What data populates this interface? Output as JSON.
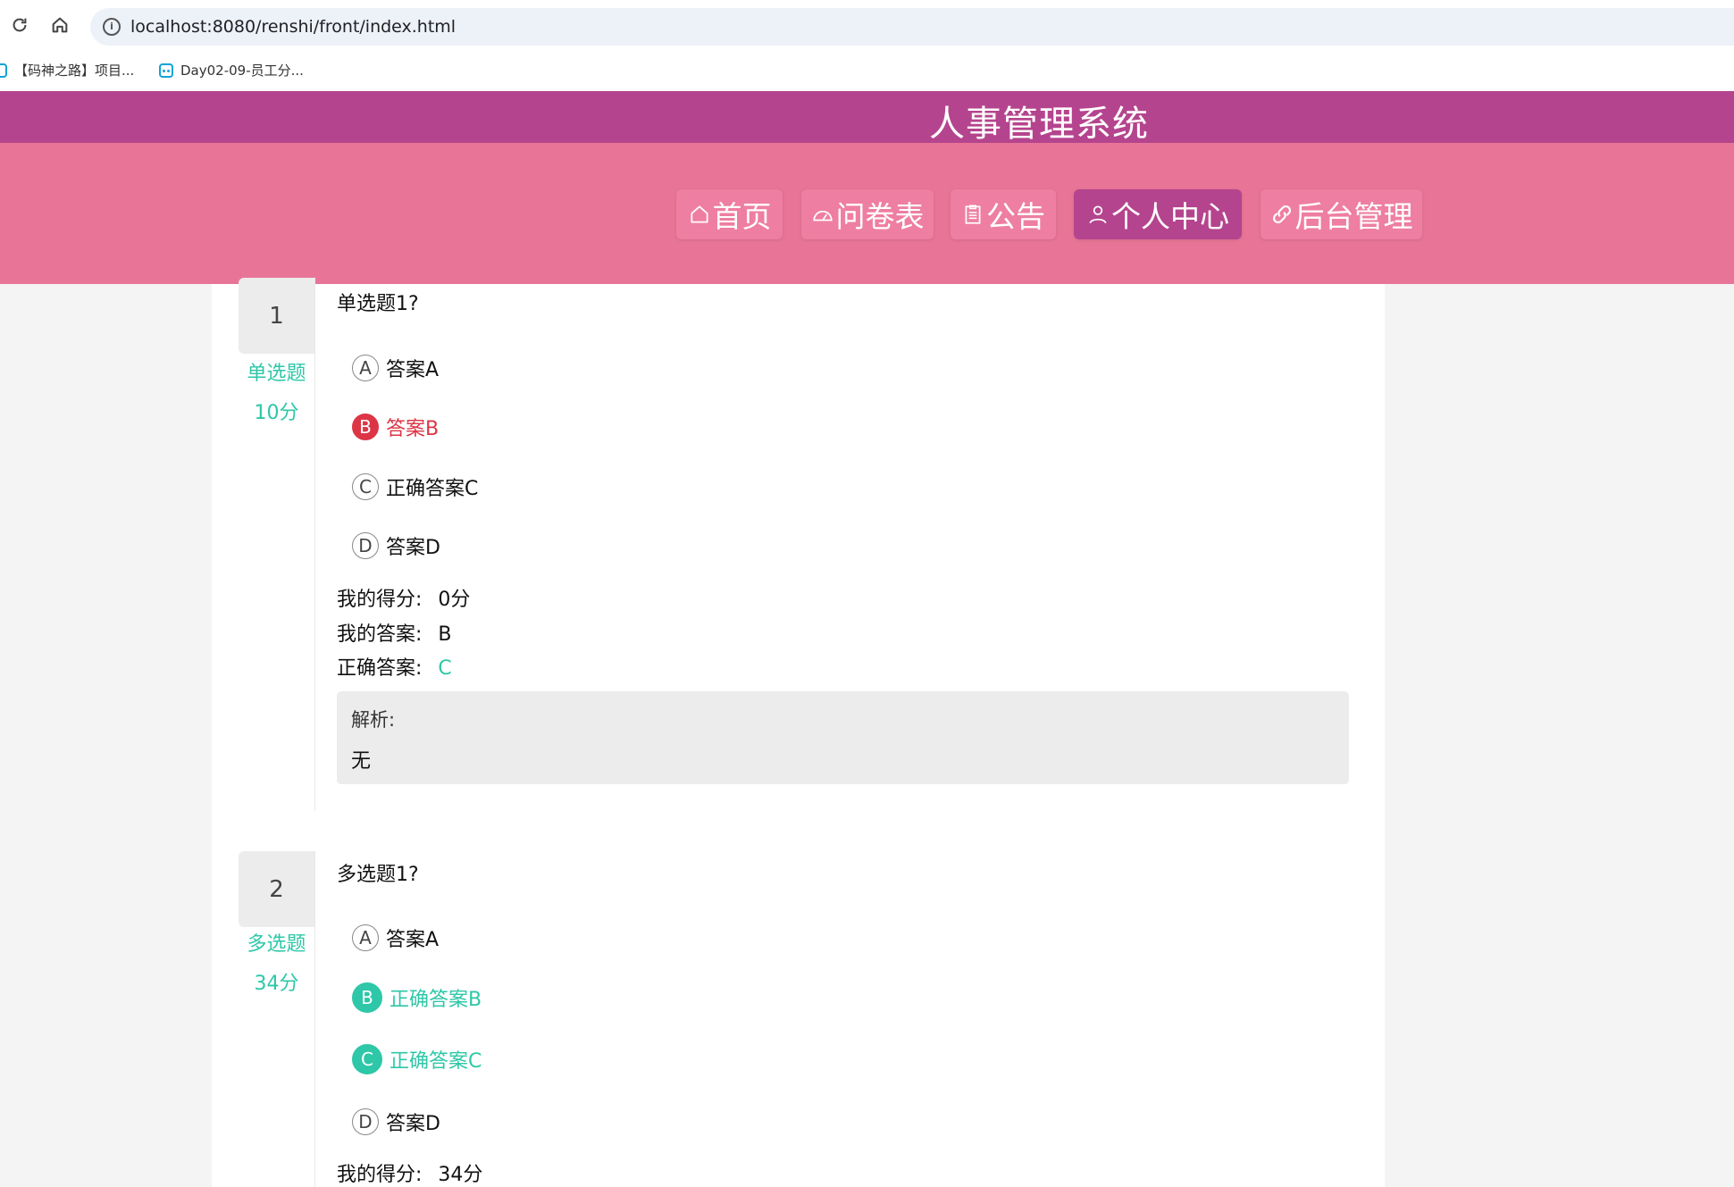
{
  "browser": {
    "url": "localhost:8080/renshi/front/index.html",
    "bookmarks": [
      "【码神之路】项目...",
      "Day02-09-员工分..."
    ]
  },
  "site": {
    "title": "人事管理系统",
    "nav": [
      "首页",
      "问卷表",
      "公告",
      "个人中心",
      "后台管理"
    ],
    "active_nav": "个人中心"
  },
  "labels": {
    "my_score": "我的得分:",
    "my_answer": "我的答案:",
    "correct_answer": "正确答案:",
    "analysis": "解析:"
  },
  "questions": [
    {
      "number": "1",
      "type": "单选题",
      "score": "10分",
      "text": "单选题1?",
      "options": [
        {
          "letter": "A",
          "text": "答案A",
          "state": "normal"
        },
        {
          "letter": "B",
          "text": "答案B",
          "state": "wrong"
        },
        {
          "letter": "C",
          "text": "正确答案C",
          "state": "normal"
        },
        {
          "letter": "D",
          "text": "答案D",
          "state": "normal"
        }
      ],
      "my_score": "0分",
      "my_answer": "B",
      "correct_answer": "C",
      "analysis": "无"
    },
    {
      "number": "2",
      "type": "多选题",
      "score": "34分",
      "text": "多选题1?",
      "options": [
        {
          "letter": "A",
          "text": "答案A",
          "state": "normal"
        },
        {
          "letter": "B",
          "text": "正确答案B",
          "state": "right"
        },
        {
          "letter": "C",
          "text": "正确答案C",
          "state": "right"
        },
        {
          "letter": "D",
          "text": "答案D",
          "state": "normal"
        }
      ],
      "my_score": "34分"
    }
  ],
  "colors": {
    "title_bar": "#b5448e",
    "nav_bar": "#e87597",
    "correct": "#2ec7a8",
    "wrong": "#dc3545"
  }
}
